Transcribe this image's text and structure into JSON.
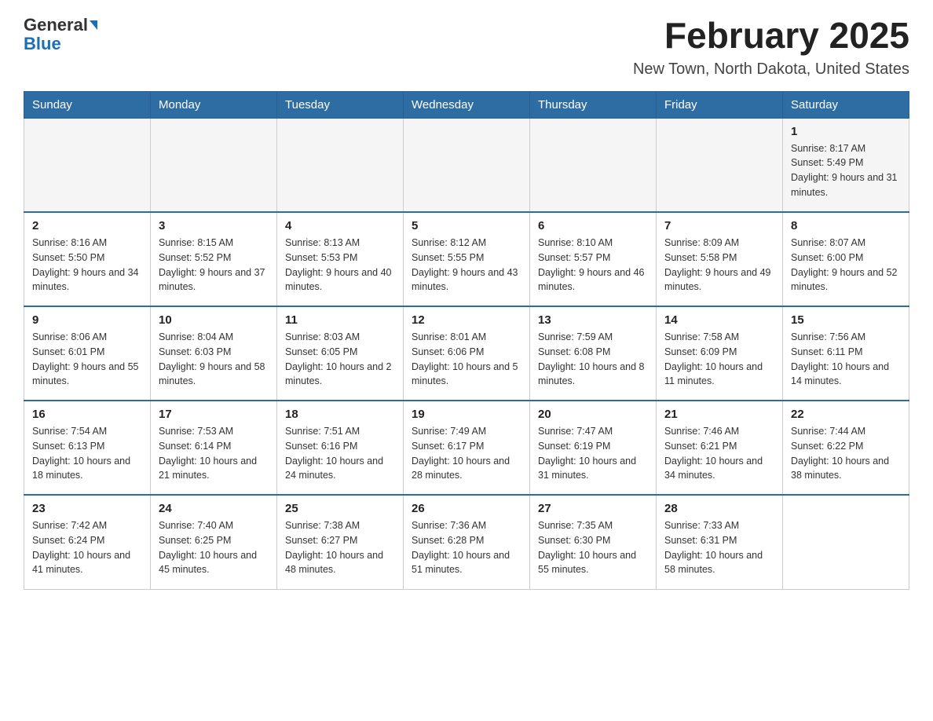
{
  "header": {
    "logo_general": "General",
    "logo_blue": "Blue",
    "month_title": "February 2025",
    "location": "New Town, North Dakota, United States"
  },
  "days_of_week": [
    "Sunday",
    "Monday",
    "Tuesday",
    "Wednesday",
    "Thursday",
    "Friday",
    "Saturday"
  ],
  "weeks": [
    {
      "days": [
        {
          "number": "",
          "info": ""
        },
        {
          "number": "",
          "info": ""
        },
        {
          "number": "",
          "info": ""
        },
        {
          "number": "",
          "info": ""
        },
        {
          "number": "",
          "info": ""
        },
        {
          "number": "",
          "info": ""
        },
        {
          "number": "1",
          "info": "Sunrise: 8:17 AM\nSunset: 5:49 PM\nDaylight: 9 hours and 31 minutes."
        }
      ]
    },
    {
      "days": [
        {
          "number": "2",
          "info": "Sunrise: 8:16 AM\nSunset: 5:50 PM\nDaylight: 9 hours and 34 minutes."
        },
        {
          "number": "3",
          "info": "Sunrise: 8:15 AM\nSunset: 5:52 PM\nDaylight: 9 hours and 37 minutes."
        },
        {
          "number": "4",
          "info": "Sunrise: 8:13 AM\nSunset: 5:53 PM\nDaylight: 9 hours and 40 minutes."
        },
        {
          "number": "5",
          "info": "Sunrise: 8:12 AM\nSunset: 5:55 PM\nDaylight: 9 hours and 43 minutes."
        },
        {
          "number": "6",
          "info": "Sunrise: 8:10 AM\nSunset: 5:57 PM\nDaylight: 9 hours and 46 minutes."
        },
        {
          "number": "7",
          "info": "Sunrise: 8:09 AM\nSunset: 5:58 PM\nDaylight: 9 hours and 49 minutes."
        },
        {
          "number": "8",
          "info": "Sunrise: 8:07 AM\nSunset: 6:00 PM\nDaylight: 9 hours and 52 minutes."
        }
      ]
    },
    {
      "days": [
        {
          "number": "9",
          "info": "Sunrise: 8:06 AM\nSunset: 6:01 PM\nDaylight: 9 hours and 55 minutes."
        },
        {
          "number": "10",
          "info": "Sunrise: 8:04 AM\nSunset: 6:03 PM\nDaylight: 9 hours and 58 minutes."
        },
        {
          "number": "11",
          "info": "Sunrise: 8:03 AM\nSunset: 6:05 PM\nDaylight: 10 hours and 2 minutes."
        },
        {
          "number": "12",
          "info": "Sunrise: 8:01 AM\nSunset: 6:06 PM\nDaylight: 10 hours and 5 minutes."
        },
        {
          "number": "13",
          "info": "Sunrise: 7:59 AM\nSunset: 6:08 PM\nDaylight: 10 hours and 8 minutes."
        },
        {
          "number": "14",
          "info": "Sunrise: 7:58 AM\nSunset: 6:09 PM\nDaylight: 10 hours and 11 minutes."
        },
        {
          "number": "15",
          "info": "Sunrise: 7:56 AM\nSunset: 6:11 PM\nDaylight: 10 hours and 14 minutes."
        }
      ]
    },
    {
      "days": [
        {
          "number": "16",
          "info": "Sunrise: 7:54 AM\nSunset: 6:13 PM\nDaylight: 10 hours and 18 minutes."
        },
        {
          "number": "17",
          "info": "Sunrise: 7:53 AM\nSunset: 6:14 PM\nDaylight: 10 hours and 21 minutes."
        },
        {
          "number": "18",
          "info": "Sunrise: 7:51 AM\nSunset: 6:16 PM\nDaylight: 10 hours and 24 minutes."
        },
        {
          "number": "19",
          "info": "Sunrise: 7:49 AM\nSunset: 6:17 PM\nDaylight: 10 hours and 28 minutes."
        },
        {
          "number": "20",
          "info": "Sunrise: 7:47 AM\nSunset: 6:19 PM\nDaylight: 10 hours and 31 minutes."
        },
        {
          "number": "21",
          "info": "Sunrise: 7:46 AM\nSunset: 6:21 PM\nDaylight: 10 hours and 34 minutes."
        },
        {
          "number": "22",
          "info": "Sunrise: 7:44 AM\nSunset: 6:22 PM\nDaylight: 10 hours and 38 minutes."
        }
      ]
    },
    {
      "days": [
        {
          "number": "23",
          "info": "Sunrise: 7:42 AM\nSunset: 6:24 PM\nDaylight: 10 hours and 41 minutes."
        },
        {
          "number": "24",
          "info": "Sunrise: 7:40 AM\nSunset: 6:25 PM\nDaylight: 10 hours and 45 minutes."
        },
        {
          "number": "25",
          "info": "Sunrise: 7:38 AM\nSunset: 6:27 PM\nDaylight: 10 hours and 48 minutes."
        },
        {
          "number": "26",
          "info": "Sunrise: 7:36 AM\nSunset: 6:28 PM\nDaylight: 10 hours and 51 minutes."
        },
        {
          "number": "27",
          "info": "Sunrise: 7:35 AM\nSunset: 6:30 PM\nDaylight: 10 hours and 55 minutes."
        },
        {
          "number": "28",
          "info": "Sunrise: 7:33 AM\nSunset: 6:31 PM\nDaylight: 10 hours and 58 minutes."
        },
        {
          "number": "",
          "info": ""
        }
      ]
    }
  ]
}
